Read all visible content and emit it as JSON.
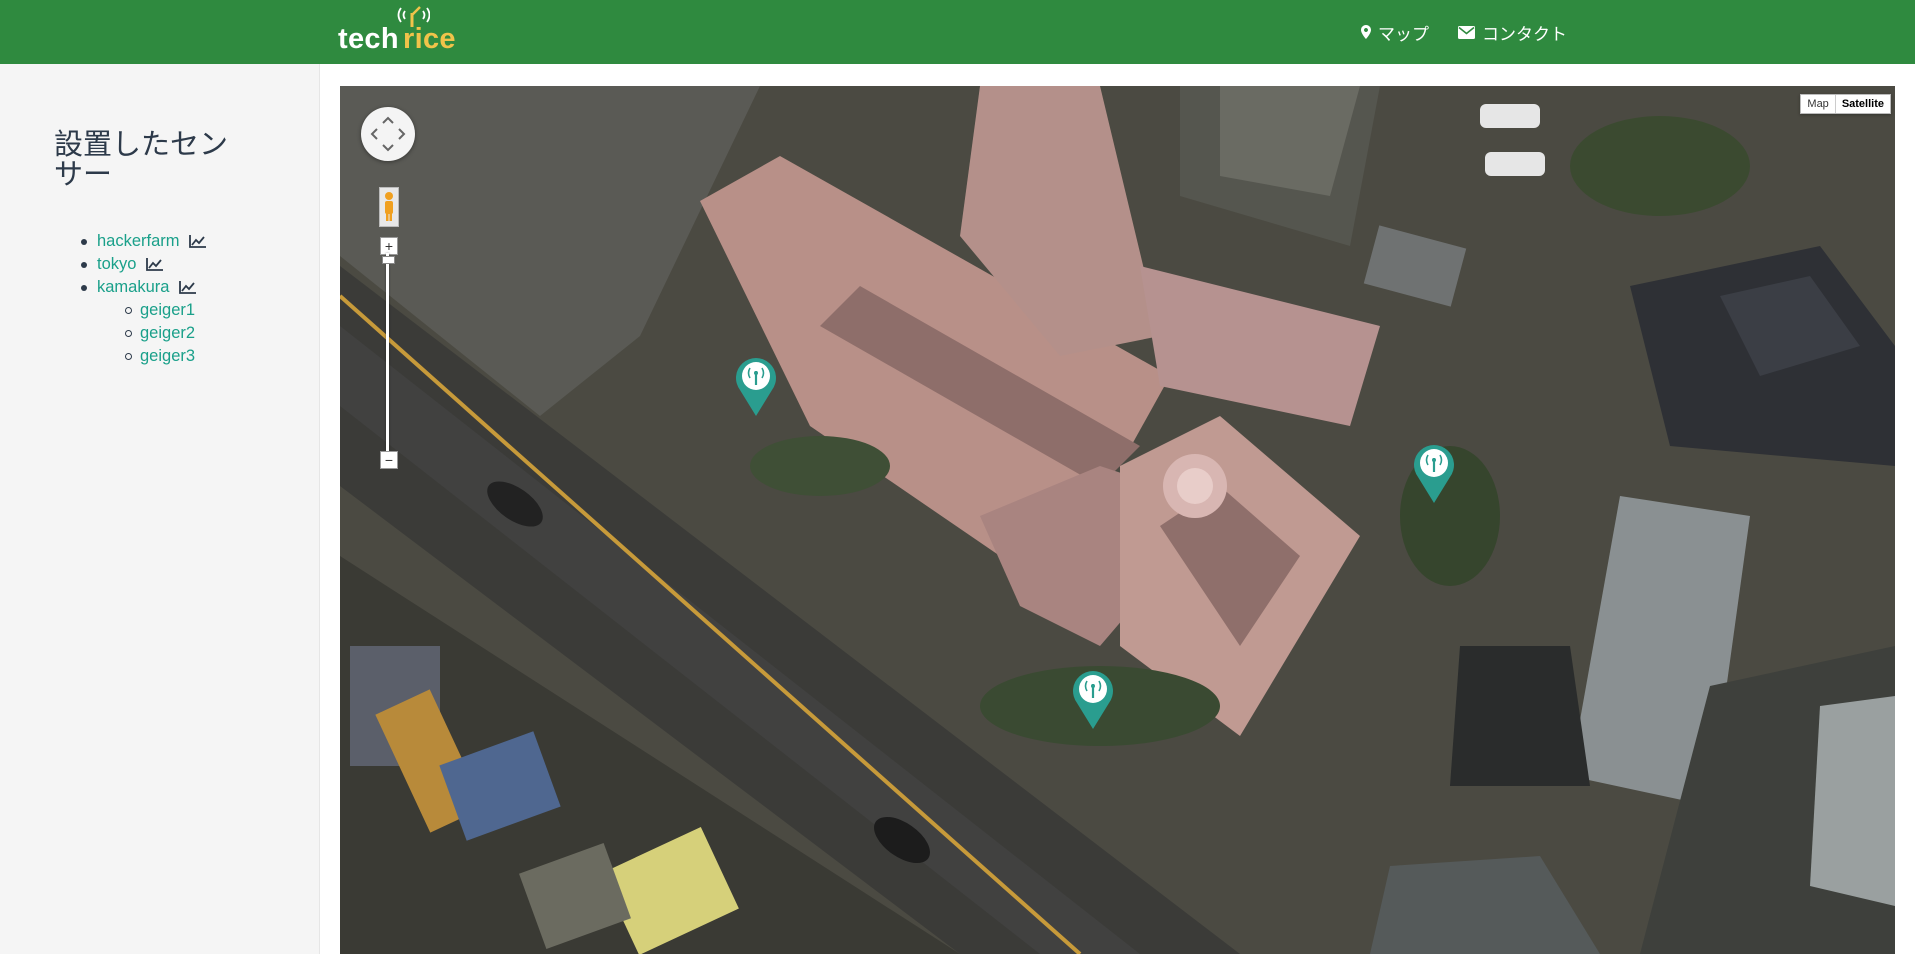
{
  "navbar": {
    "logo_tech": "tech",
    "logo_rice": "rice",
    "links": [
      {
        "label": "マップ",
        "icon": "map-marker-icon"
      },
      {
        "label": "コンタクト",
        "icon": "envelope-icon"
      }
    ]
  },
  "sidebar": {
    "title": "設置したセンサー",
    "sensors": [
      {
        "label": "hackerfarm",
        "icon": "line-chart-icon"
      },
      {
        "label": "tokyo",
        "icon": "line-chart-icon"
      },
      {
        "label": "kamakura",
        "icon": "line-chart-icon",
        "children": [
          "geiger1",
          "geiger2",
          "geiger3"
        ]
      }
    ]
  },
  "map": {
    "type_buttons": [
      "Map",
      "Satellite"
    ],
    "active_type": "Satellite",
    "zoom_in": "+",
    "zoom_out": "−",
    "marker_count": 3
  },
  "colors": {
    "navbar": "#2f8a3f",
    "link": "#1aa08a",
    "marker": "#2a9d8f",
    "logo_accent": "#f0c34a"
  }
}
